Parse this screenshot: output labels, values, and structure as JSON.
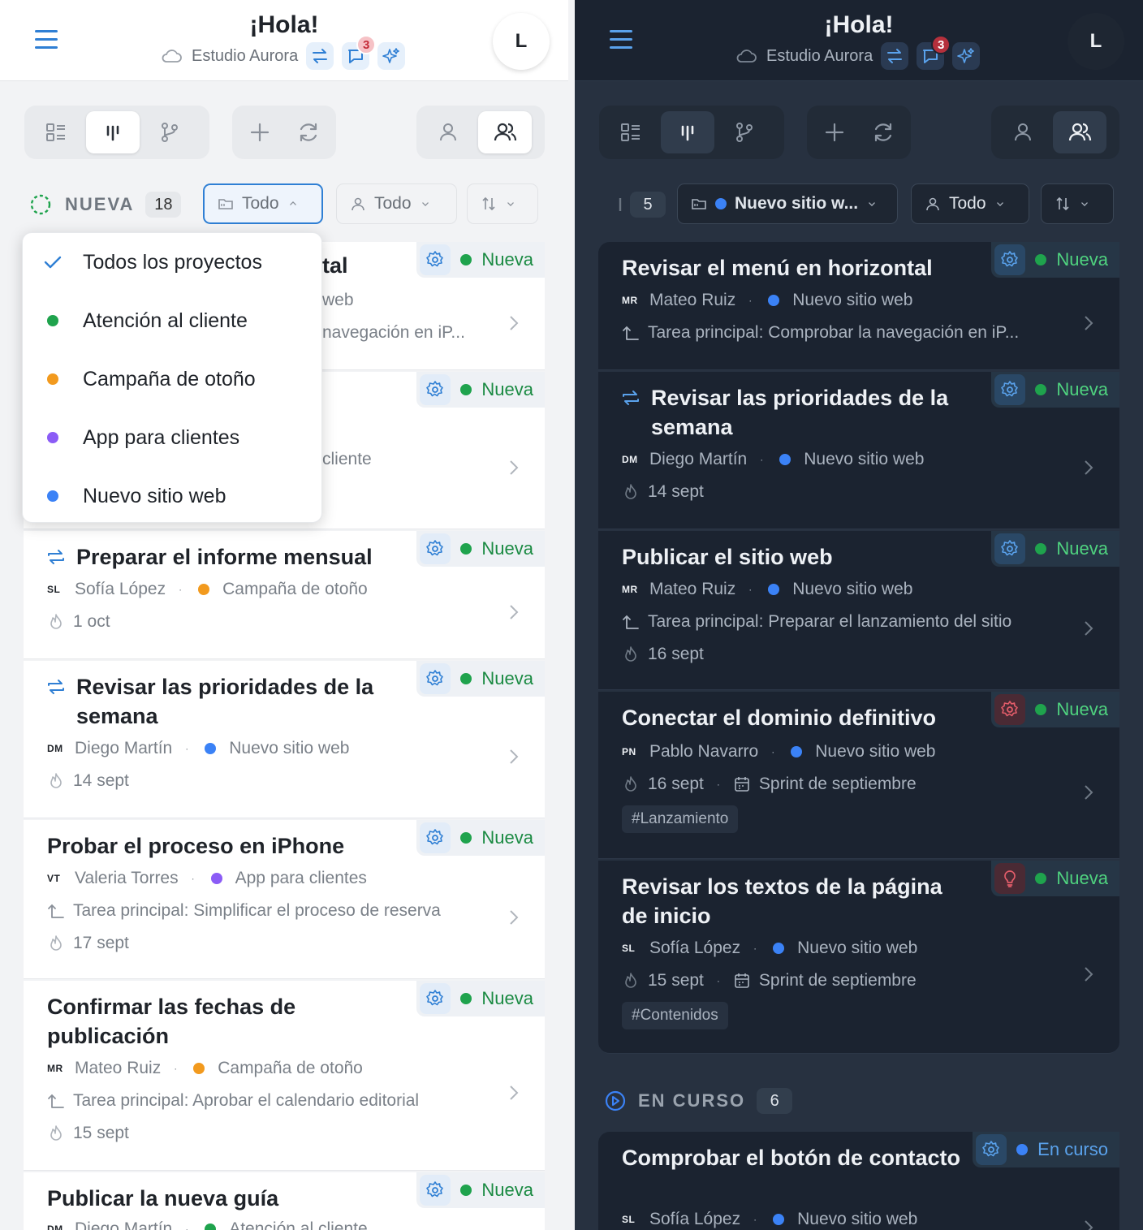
{
  "header": {
    "title": "¡Hola!",
    "workspace": "Estudio Aurora",
    "notifications": "3",
    "avatar_initial": "L"
  },
  "light": {
    "group": {
      "label": "NUEVA",
      "count": "18"
    },
    "project_filter": "Todo",
    "person_filter": "Todo",
    "dropdown": {
      "items": [
        {
          "label": "Todos los proyectos",
          "color": "#2f7fd4",
          "checked": true
        },
        {
          "label": "Atención al cliente",
          "color": "#1fa34d"
        },
        {
          "label": "Campaña de otoño",
          "color": "#f29a1e"
        },
        {
          "label": "App para clientes",
          "color": "#8b5cf6"
        },
        {
          "label": "Nuevo sitio web",
          "color": "#3b82f6"
        }
      ]
    },
    "peek": [
      "tal",
      "web",
      "navegación en iP...",
      "cliente"
    ],
    "cards": [
      {
        "status": "Nueva"
      },
      {
        "status": "Nueva"
      },
      {
        "title": "Preparar el informe mensual",
        "initials": "SL",
        "assignee": "Sofía López",
        "project": "Campaña de otoño",
        "project_color": "#f29a1e",
        "date": "1 oct",
        "status": "Nueva",
        "recurring": true
      },
      {
        "title": "Revisar las prioridades de la semana",
        "initials": "DM",
        "assignee": "Diego Martín",
        "project": "Nuevo sitio web",
        "project_color": "#3b82f6",
        "date": "14 sept",
        "status": "Nueva",
        "recurring": true
      },
      {
        "title": "Probar el proceso en iPhone",
        "initials": "VT",
        "assignee": "Valeria Torres",
        "project": "App para clientes",
        "project_color": "#8b5cf6",
        "parent": "Tarea principal: Simplificar el proceso de reserva",
        "date": "17 sept",
        "status": "Nueva"
      },
      {
        "title": "Confirmar las fechas de publicación",
        "initials": "MR",
        "assignee": "Mateo Ruiz",
        "project": "Campaña de otoño",
        "project_color": "#f29a1e",
        "parent": "Tarea principal: Aprobar el calendario editorial",
        "date": "15 sept",
        "status": "Nueva"
      },
      {
        "title": "Publicar la nueva guía",
        "initials": "DM",
        "assignee": "Diego Martín",
        "project": "Atención al cliente",
        "project_color": "#1fa34d",
        "status": "Nueva"
      }
    ]
  },
  "dark": {
    "group": {
      "count": "5"
    },
    "project_filter": "Nuevo sitio w...",
    "person_filter": "Todo",
    "cards": [
      {
        "title": "Revisar el menú en horizontal",
        "initials": "MR",
        "assignee": "Mateo Ruiz",
        "project": "Nuevo sitio web",
        "parent": "Tarea principal: Comprobar la navegación en iP...",
        "status": "Nueva"
      },
      {
        "title": "Revisar las prioridades de la semana",
        "initials": "DM",
        "assignee": "Diego Martín",
        "project": "Nuevo sitio web",
        "date": "14 sept",
        "status": "Nueva",
        "recurring": true
      },
      {
        "title": "Publicar el sitio web",
        "initials": "MR",
        "assignee": "Mateo Ruiz",
        "project": "Nuevo sitio web",
        "parent": "Tarea principal: Preparar el lanzamiento del sitio",
        "date": "16 sept",
        "status": "Nueva"
      },
      {
        "title": "Conectar el dominio definitivo",
        "initials": "PN",
        "assignee": "Pablo Navarro",
        "project": "Nuevo sitio web",
        "date": "16 sept",
        "sprint": "Sprint de septiembre",
        "tag": "#Lanzamiento",
        "status": "Nueva",
        "icon": "red-gear"
      },
      {
        "title": "Revisar los textos de la página de inicio",
        "initials": "SL",
        "assignee": "Sofía López",
        "project": "Nuevo sitio web",
        "date": "15 sept",
        "sprint": "Sprint de septiembre",
        "tag": "#Contenidos",
        "status": "Nueva",
        "icon": "bulb"
      }
    ],
    "section2": {
      "label": "EN CURSO",
      "count": "6"
    },
    "card2": {
      "title": "Comprobar el botón de contacto",
      "initials": "SL",
      "assignee": "Sofía López",
      "project": "Nuevo sitio web",
      "status": "En curso"
    }
  },
  "icons": [
    "menu-icon",
    "cloud-icon",
    "transfer-icon",
    "chat-icon",
    "sparkle-icon",
    "list-view-icon",
    "board-view-icon",
    "branch-icon",
    "plus-icon",
    "refresh-icon",
    "user-icon",
    "users-icon",
    "folder-icon",
    "chevron-down-icon",
    "sort-icon",
    "gear-icon",
    "flame-icon",
    "parent-task-icon",
    "calendar-icon",
    "bulb-icon",
    "chevron-right-icon",
    "check-icon",
    "repeat-icon"
  ],
  "colors": {
    "accent": "#2f7fd4",
    "status_new": "#1fa34d",
    "status_progress": "#3b82f6"
  }
}
